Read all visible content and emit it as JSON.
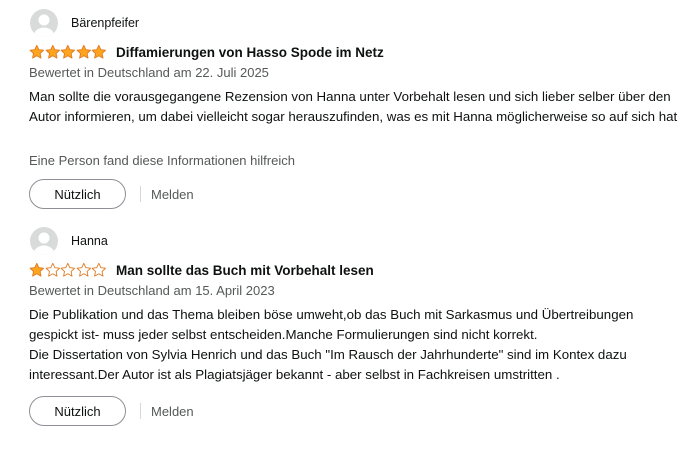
{
  "colors": {
    "star_fill": "#ffa41c",
    "star_outline": "#de7921",
    "muted_text": "#565959",
    "avatar_bg": "#d9dbdb"
  },
  "reviews": [
    {
      "author": "Bärenpfeifer",
      "avatar_icon": "default-avatar-icon",
      "rating": 5,
      "title": "Diffamierungen von Hasso Spode im Netz",
      "meta": "Bewertet in Deutschland am 22. Juli 2025",
      "body": [
        "Man sollte die vorausgegangene Rezension von Hanna unter Vorbehalt lesen und sich lieber selber über den Autor informieren, um dabei vielleicht sogar herauszufinden, was es mit Hanna möglicherweise so auf sich hat"
      ],
      "helpful_text": "Eine Person fand diese Informationen hilfreich",
      "helpful_button": "Nützlich",
      "report_link": "Melden"
    },
    {
      "author": "Hanna",
      "avatar_icon": "default-avatar-icon",
      "rating": 1,
      "title": "Man sollte das Buch mit Vorbehalt lesen",
      "meta": "Bewertet in Deutschland am 15. April 2023",
      "body": [
        "Die Publikation und das Thema bleiben böse umweht,ob das Buch mit Sarkasmus und Übertreibungen gespickt ist- muss jeder selbst entscheiden.Manche Formulierungen sind nicht korrekt.",
        "Die Dissertation von Sylvia Henrich und das Buch \"Im Rausch der Jahrhunderte\" sind im Kontex dazu interessant.Der Autor ist als Plagiatsjäger bekannt - aber selbst in Fachkreisen umstritten ."
      ],
      "helpful_button": "Nützlich",
      "report_link": "Melden"
    }
  ]
}
